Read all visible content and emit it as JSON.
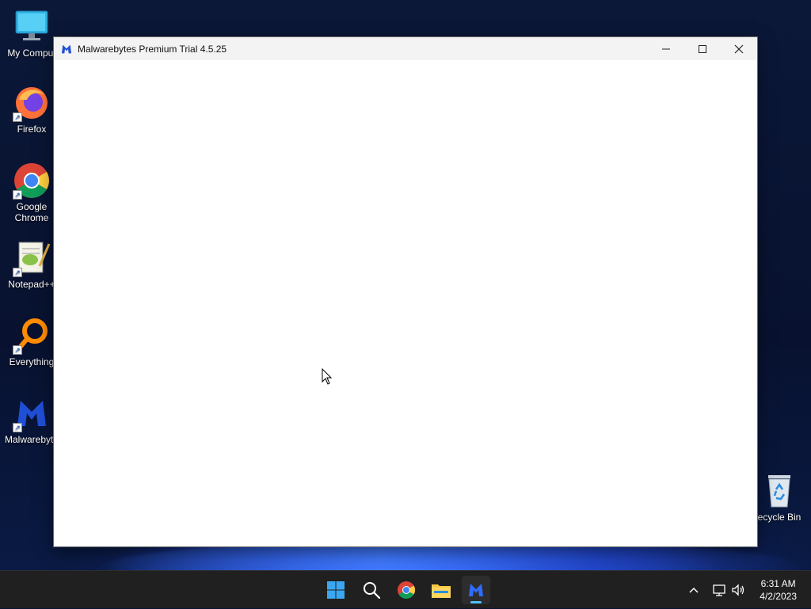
{
  "desktop": {
    "icons": [
      {
        "label": "My Comput",
        "icon": "monitor-icon"
      },
      {
        "label": "Firefox",
        "icon": "firefox-icon"
      },
      {
        "label": "Google Chrome",
        "icon": "chrome-icon"
      },
      {
        "label": "Notepad++",
        "icon": "notepadpp-icon"
      },
      {
        "label": "Everything",
        "icon": "everything-icon"
      },
      {
        "label": "Malwarebyte",
        "icon": "malwarebytes-icon"
      }
    ],
    "recycle_bin": {
      "label": "ecycle Bin",
      "icon": "recycle-bin-icon"
    }
  },
  "window": {
    "title": "Malwarebytes Premium Trial  4.5.25",
    "icon": "malwarebytes-icon",
    "controls": [
      "minimize-icon",
      "maximize-icon",
      "close-icon"
    ]
  },
  "taskbar": {
    "apps": [
      "start-icon",
      "search-icon",
      "chrome-icon",
      "file-explorer-icon",
      "malwarebytes-icon"
    ],
    "active_app": "malwarebytes-icon",
    "tray_icons": [
      "chevron-up-icon",
      "network-icon",
      "volume-icon"
    ],
    "time": "6:31 AM",
    "date": "4/2/2023"
  },
  "colors": {
    "accent": "#4cc2ff",
    "malwarebytes_blue": "#1f4fd6"
  }
}
